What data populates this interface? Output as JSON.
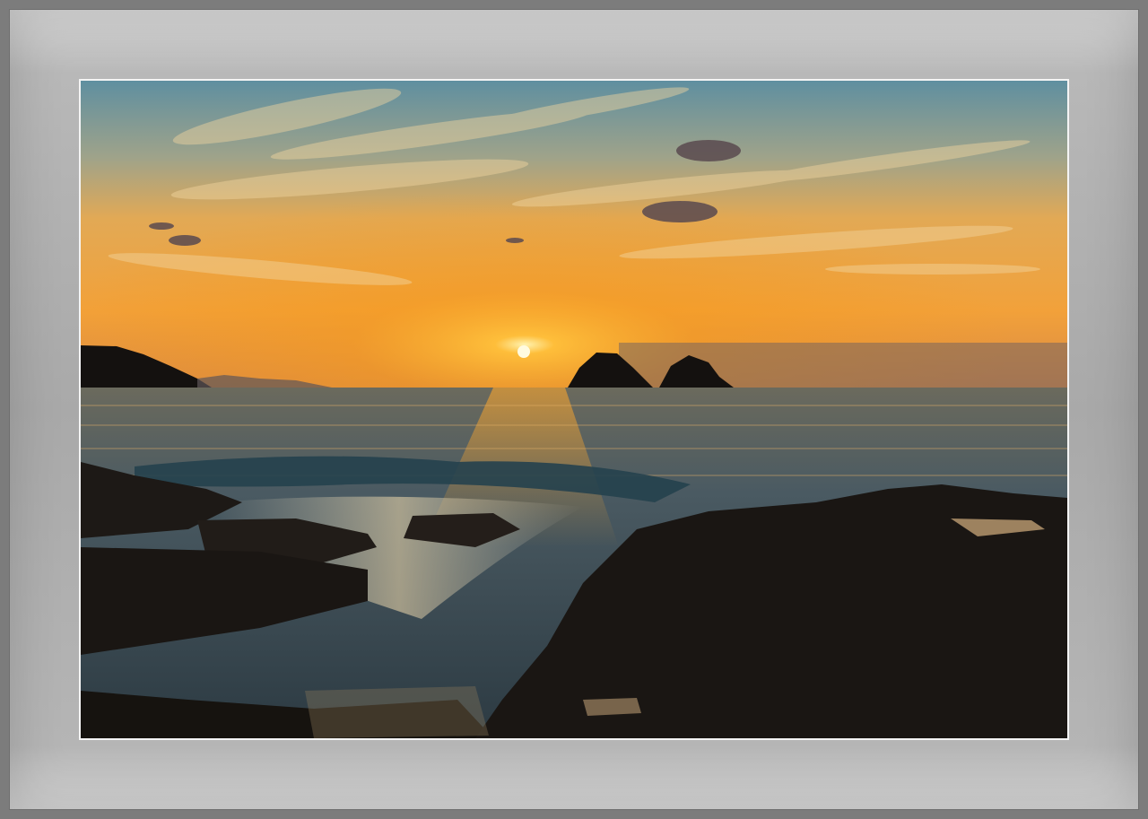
{
  "scene": {
    "subject": "sunset-over-sea",
    "colors": {
      "sky_top": "#5f8fa0",
      "sky_mid": "#e9a94a",
      "sky_glow": "#f39a1c",
      "horizon": "#f0891c",
      "sea": "#3f5866",
      "rock": "#1b1714",
      "frame_mat": "#b0b0b0",
      "frame_border": "#f4f4f4"
    }
  }
}
